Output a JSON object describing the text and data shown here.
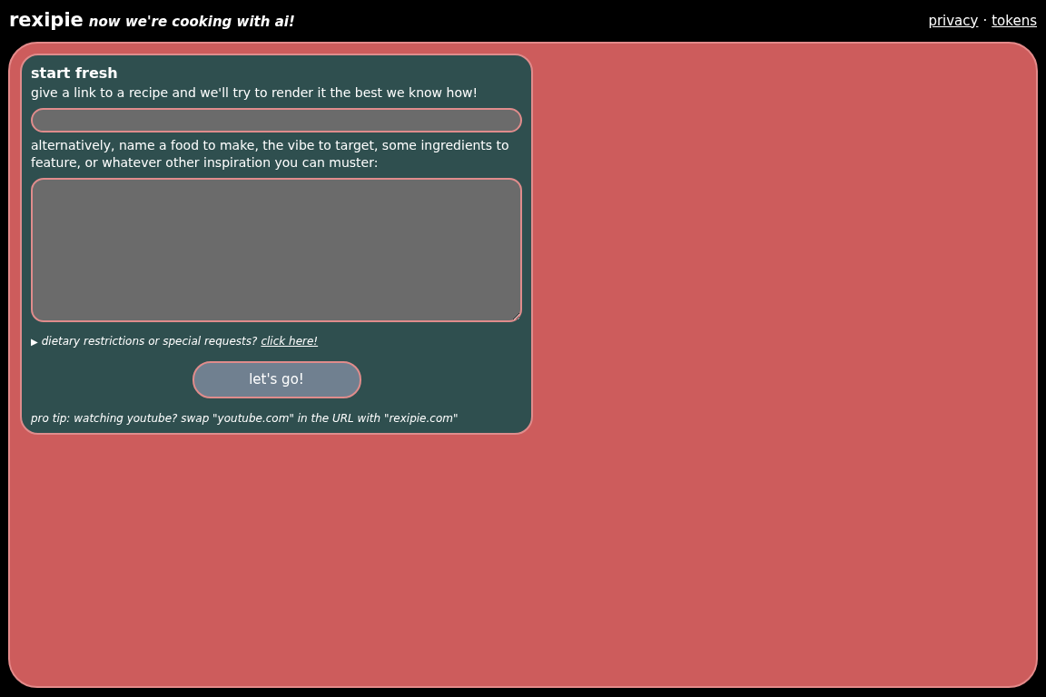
{
  "header": {
    "logo": "rexipie",
    "tagline": "now we're cooking with ai!",
    "links": [
      {
        "label": "privacy"
      },
      {
        "label": "tokens"
      }
    ],
    "separator": "·"
  },
  "card": {
    "title": "start fresh",
    "link_prompt": "give a link to a recipe and we'll try to render it the best we know how!",
    "idea_prompt": "alternatively, name a food to make, the vibe to target, some ingredients to feature, or whatever other inspiration you can muster:",
    "disclosure": {
      "marker": "▶",
      "text": "dietary restrictions or special requests?",
      "link": "click here!"
    },
    "button": "let's go!",
    "tip": "pro tip: watching youtube? swap \"youtube.com\" in the URL with \"rexipie.com\""
  }
}
